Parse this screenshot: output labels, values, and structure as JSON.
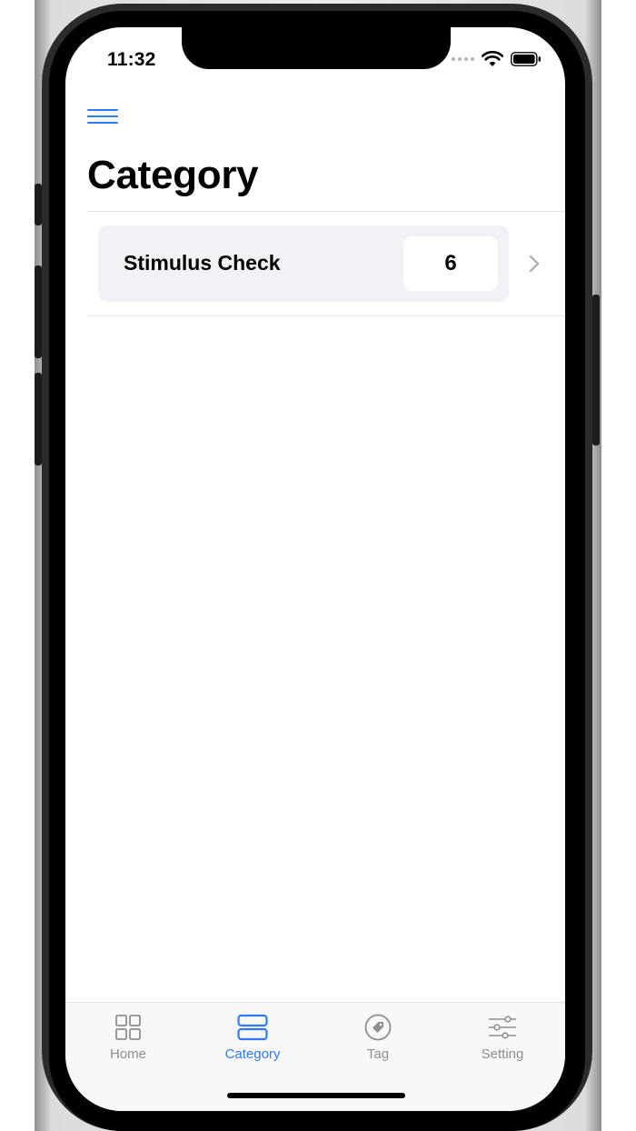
{
  "status": {
    "time": "11:32"
  },
  "nav": {
    "menu_icon": "hamburger-icon"
  },
  "page": {
    "title": "Category"
  },
  "categories": [
    {
      "label": "Stimulus Check",
      "count": "6"
    }
  ],
  "tabs": [
    {
      "label": "Home",
      "icon": "grid-icon",
      "active": false
    },
    {
      "label": "Category",
      "icon": "stack-icon",
      "active": true
    },
    {
      "label": "Tag",
      "icon": "tag-icon",
      "active": false
    },
    {
      "label": "Setting",
      "icon": "sliders-icon",
      "active": false
    }
  ],
  "colors": {
    "accent": "#2f7bf5",
    "inactive": "#8e8e93",
    "row_background": "#f2f2f6"
  }
}
